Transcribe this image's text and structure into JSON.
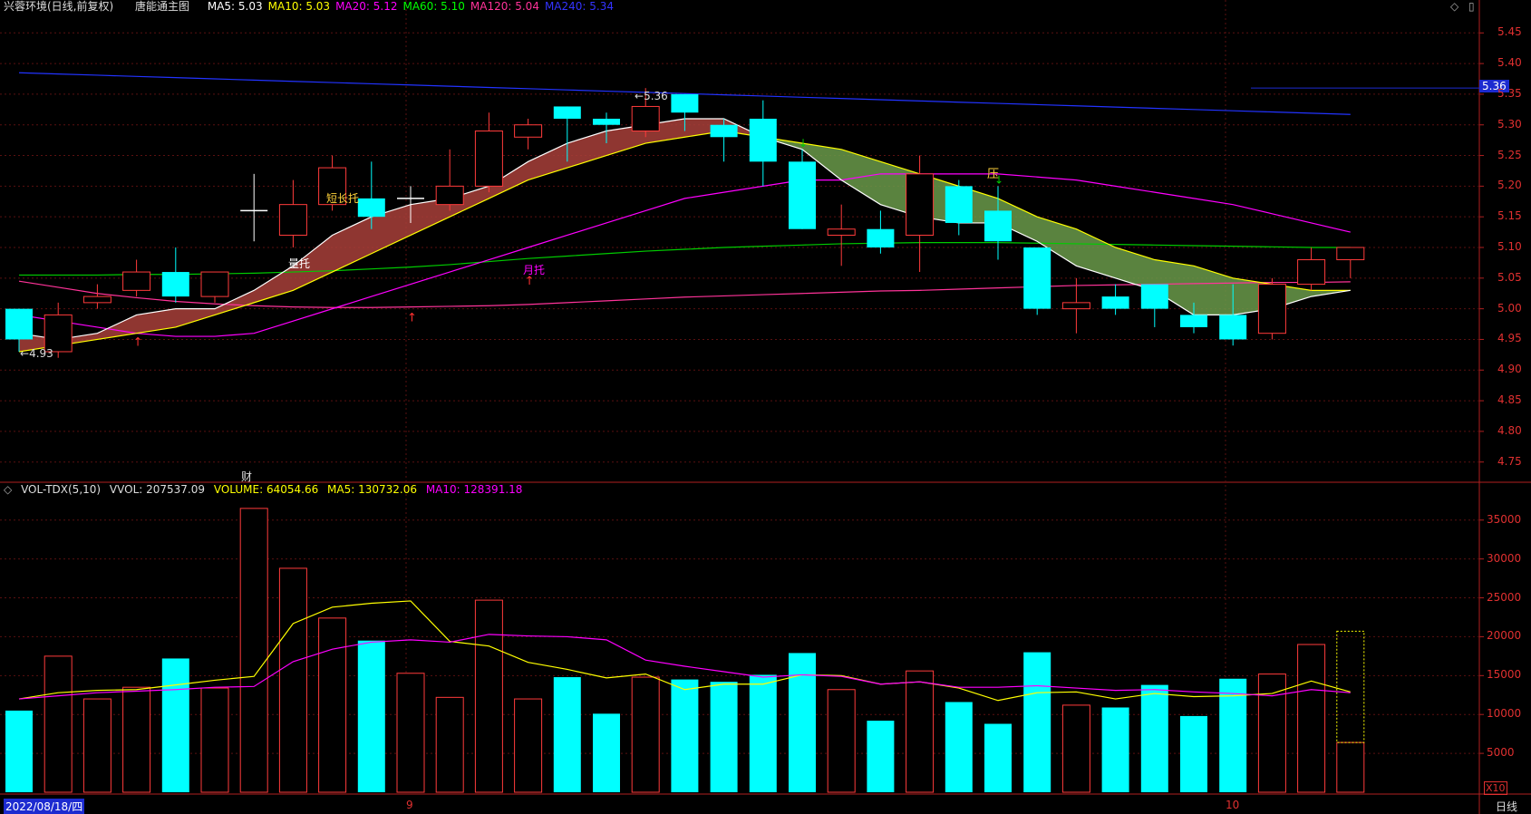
{
  "header": {
    "stock": "兴蓉环境(日线,前复权)",
    "indicator": "唐能通主图",
    "ma": [
      {
        "label": "MA5: 5.03",
        "color": "#ffffff"
      },
      {
        "label": "MA10: 5.03",
        "color": "#ffff00"
      },
      {
        "label": "MA20: 5.12",
        "color": "#ff00ff"
      },
      {
        "label": "MA60: 5.10",
        "color": "#00ff00"
      },
      {
        "label": "MA120: 5.04",
        "color": "#ff3399"
      },
      {
        "label": "MA240: 5.34",
        "color": "#3333ff"
      }
    ],
    "icons": [
      "diamond-icon",
      "window-icon"
    ]
  },
  "vol_header": {
    "name": "VOL-TDX(5,10)",
    "vvol": "VVOL: 207537.09",
    "volume": "VOLUME: 64054.66",
    "ma5": "MA5: 130732.06",
    "ma10": "MA10: 128391.18"
  },
  "price_axis": {
    "ticks": [
      "5.45",
      "5.40",
      "5.35",
      "5.30",
      "5.25",
      "5.20",
      "5.15",
      "5.10",
      "5.05",
      "5.00",
      "4.95",
      "4.90",
      "4.85",
      "4.80",
      "4.75"
    ],
    "min": 4.72,
    "max": 5.48,
    "current": "5.36"
  },
  "vol_axis": {
    "ticks": [
      "35000",
      "30000",
      "25000",
      "20000",
      "15000",
      "10000",
      "5000"
    ],
    "max": 38000,
    "unit": "X10"
  },
  "annotations": {
    "high": "5.36",
    "low": "4.93",
    "yali": "压",
    "liangtuo": "量托",
    "duanchangtuo": "短长托",
    "yuetuo": "月托",
    "cai": "财"
  },
  "bottom": {
    "date": "2022/08/18/四",
    "m9": "9",
    "m10": "10",
    "period": "日线"
  },
  "colors": {
    "up": "#ff3b3b",
    "down": "#00ffff",
    "ma5": "#ffffff",
    "ma10": "#ffff00",
    "ma20": "#ff00ff",
    "ma60": "#00cc00",
    "ma120": "#ff3399",
    "ma240": "#2233ff"
  },
  "chart_data": {
    "type": "candlestick",
    "candles": [
      {
        "o": 5.0,
        "c": 4.95,
        "h": 5.0,
        "l": 4.93
      },
      {
        "o": 4.93,
        "c": 4.99,
        "h": 5.01,
        "l": 4.92
      },
      {
        "o": 5.01,
        "c": 5.02,
        "h": 5.04,
        "l": 5.0
      },
      {
        "o": 5.03,
        "c": 5.06,
        "h": 5.08,
        "l": 5.02
      },
      {
        "o": 5.06,
        "c": 5.02,
        "h": 5.1,
        "l": 5.01
      },
      {
        "o": 5.02,
        "c": 5.06,
        "h": 5.06,
        "l": 5.01
      },
      {
        "o": 5.16,
        "c": 5.16,
        "h": 5.22,
        "l": 5.11
      },
      {
        "o": 5.12,
        "c": 5.17,
        "h": 5.21,
        "l": 5.1
      },
      {
        "o": 5.17,
        "c": 5.23,
        "h": 5.25,
        "l": 5.16
      },
      {
        "o": 5.18,
        "c": 5.15,
        "h": 5.24,
        "l": 5.13
      },
      {
        "o": 5.18,
        "c": 5.18,
        "h": 5.2,
        "l": 5.14
      },
      {
        "o": 5.17,
        "c": 5.2,
        "h": 5.26,
        "l": 5.16
      },
      {
        "o": 5.2,
        "c": 5.29,
        "h": 5.32,
        "l": 5.19
      },
      {
        "o": 5.28,
        "c": 5.3,
        "h": 5.31,
        "l": 5.26
      },
      {
        "o": 5.33,
        "c": 5.31,
        "h": 5.33,
        "l": 5.24
      },
      {
        "o": 5.31,
        "c": 5.3,
        "h": 5.32,
        "l": 5.27
      },
      {
        "o": 5.29,
        "c": 5.33,
        "h": 5.36,
        "l": 5.28
      },
      {
        "o": 5.35,
        "c": 5.32,
        "h": 5.35,
        "l": 5.29
      },
      {
        "o": 5.3,
        "c": 5.28,
        "h": 5.31,
        "l": 5.24
      },
      {
        "o": 5.31,
        "c": 5.24,
        "h": 5.34,
        "l": 5.2
      },
      {
        "o": 5.24,
        "c": 5.13,
        "h": 5.26,
        "l": 5.13
      },
      {
        "o": 5.12,
        "c": 5.13,
        "h": 5.17,
        "l": 5.07
      },
      {
        "o": 5.13,
        "c": 5.1,
        "h": 5.16,
        "l": 5.09
      },
      {
        "o": 5.12,
        "c": 5.22,
        "h": 5.25,
        "l": 5.06
      },
      {
        "o": 5.2,
        "c": 5.14,
        "h": 5.21,
        "l": 5.12
      },
      {
        "o": 5.16,
        "c": 5.11,
        "h": 5.2,
        "l": 5.08
      },
      {
        "o": 5.1,
        "c": 5.0,
        "h": 5.1,
        "l": 4.99
      },
      {
        "o": 5.0,
        "c": 5.01,
        "h": 5.05,
        "l": 4.96
      },
      {
        "o": 5.02,
        "c": 5.0,
        "h": 5.04,
        "l": 4.99
      },
      {
        "o": 5.04,
        "c": 5.0,
        "h": 5.04,
        "l": 4.97
      },
      {
        "o": 4.99,
        "c": 4.97,
        "h": 5.01,
        "l": 4.96
      },
      {
        "o": 4.99,
        "c": 4.95,
        "h": 5.04,
        "l": 4.94
      },
      {
        "o": 4.96,
        "c": 5.04,
        "h": 5.05,
        "l": 4.95
      },
      {
        "o": 5.04,
        "c": 5.08,
        "h": 5.1,
        "l": 5.03
      },
      {
        "o": 5.08,
        "c": 5.1,
        "h": 5.1,
        "l": 5.05
      }
    ],
    "volumes": [
      10500,
      17500,
      12000,
      13500,
      17200,
      13400,
      36500,
      28800,
      22400,
      19500,
      15300,
      12200,
      24700,
      12000,
      14800,
      10100,
      14800,
      14500,
      14200,
      15100,
      17900,
      13200,
      9200,
      15600,
      11600,
      8800,
      18000,
      11200,
      10900,
      13800,
      9800,
      14600,
      15200,
      19000,
      6400
    ],
    "ma5": [
      4.96,
      4.95,
      4.96,
      4.99,
      5.0,
      5.0,
      5.03,
      5.07,
      5.12,
      5.15,
      5.17,
      5.18,
      5.2,
      5.24,
      5.27,
      5.29,
      5.3,
      5.31,
      5.31,
      5.28,
      5.26,
      5.21,
      5.17,
      5.15,
      5.14,
      5.14,
      5.11,
      5.07,
      5.05,
      5.03,
      4.99,
      4.99,
      5.0,
      5.02,
      5.03
    ],
    "ma10": [
      4.93,
      4.94,
      4.95,
      4.96,
      4.97,
      4.99,
      5.01,
      5.03,
      5.06,
      5.09,
      5.12,
      5.15,
      5.18,
      5.21,
      5.23,
      5.25,
      5.27,
      5.28,
      5.29,
      5.28,
      5.27,
      5.26,
      5.24,
      5.22,
      5.2,
      5.18,
      5.15,
      5.13,
      5.1,
      5.08,
      5.07,
      5.05,
      5.04,
      5.03,
      5.03
    ],
    "ma20": [
      4.99,
      4.98,
      4.97,
      4.96,
      4.955,
      4.955,
      4.96,
      4.98,
      5.0,
      5.02,
      5.04,
      5.06,
      5.08,
      5.1,
      5.12,
      5.14,
      5.16,
      5.18,
      5.19,
      5.2,
      5.21,
      5.21,
      5.22,
      5.22,
      5.22,
      5.22,
      5.215,
      5.21,
      5.2,
      5.19,
      5.18,
      5.17,
      5.155,
      5.14,
      5.125
    ],
    "ma60": [
      5.055,
      5.055,
      5.055,
      5.056,
      5.056,
      5.057,
      5.058,
      5.06,
      5.062,
      5.065,
      5.068,
      5.072,
      5.077,
      5.082,
      5.086,
      5.09,
      5.094,
      5.097,
      5.1,
      5.102,
      5.104,
      5.106,
      5.107,
      5.108,
      5.108,
      5.108,
      5.107,
      5.106,
      5.105,
      5.104,
      5.103,
      5.102,
      5.101,
      5.1,
      5.1
    ],
    "ma120": [
      5.045,
      5.035,
      5.025,
      5.018,
      5.012,
      5.008,
      5.005,
      5.003,
      5.002,
      5.002,
      5.003,
      5.004,
      5.005,
      5.007,
      5.01,
      5.013,
      5.016,
      5.019,
      5.021,
      5.023,
      5.025,
      5.027,
      5.029,
      5.03,
      5.032,
      5.034,
      5.036,
      5.038,
      5.039,
      5.04,
      5.041,
      5.042,
      5.043,
      5.043,
      5.044
    ],
    "ma240": [
      5.385,
      5.383,
      5.381,
      5.379,
      5.377,
      5.375,
      5.373,
      5.371,
      5.369,
      5.367,
      5.365,
      5.363,
      5.361,
      5.359,
      5.357,
      5.355,
      5.353,
      5.351,
      5.349,
      5.347,
      5.345,
      5.343,
      5.341,
      5.339,
      5.337,
      5.335,
      5.333,
      5.331,
      5.329,
      5.327,
      5.325,
      5.323,
      5.321,
      5.319,
      5.317
    ],
    "vol_ma5": [
      12000,
      12800,
      13100,
      13200,
      13800,
      14400,
      14900,
      21700,
      23800,
      24300,
      24600,
      19400,
      18800,
      16700,
      15800,
      14700,
      15200,
      13200,
      13900,
      13900,
      15100,
      15000,
      13900,
      14200,
      13400,
      11800,
      12800,
      12900,
      12000,
      12700,
      12300,
      12400,
      12700,
      14300,
      12900
    ],
    "vol_ma10": [
      12000,
      12400,
      12800,
      13000,
      13200,
      13500,
      13600,
      16800,
      18400,
      19300,
      19600,
      19300,
      20300,
      20100,
      20000,
      19600,
      17000,
      16200,
      15500,
      14800,
      15100,
      14900,
      13900,
      14200,
      13500,
      13500,
      13700,
      13400,
      13100,
      13200,
      12900,
      12700,
      12400,
      13200,
      12800
    ]
  }
}
